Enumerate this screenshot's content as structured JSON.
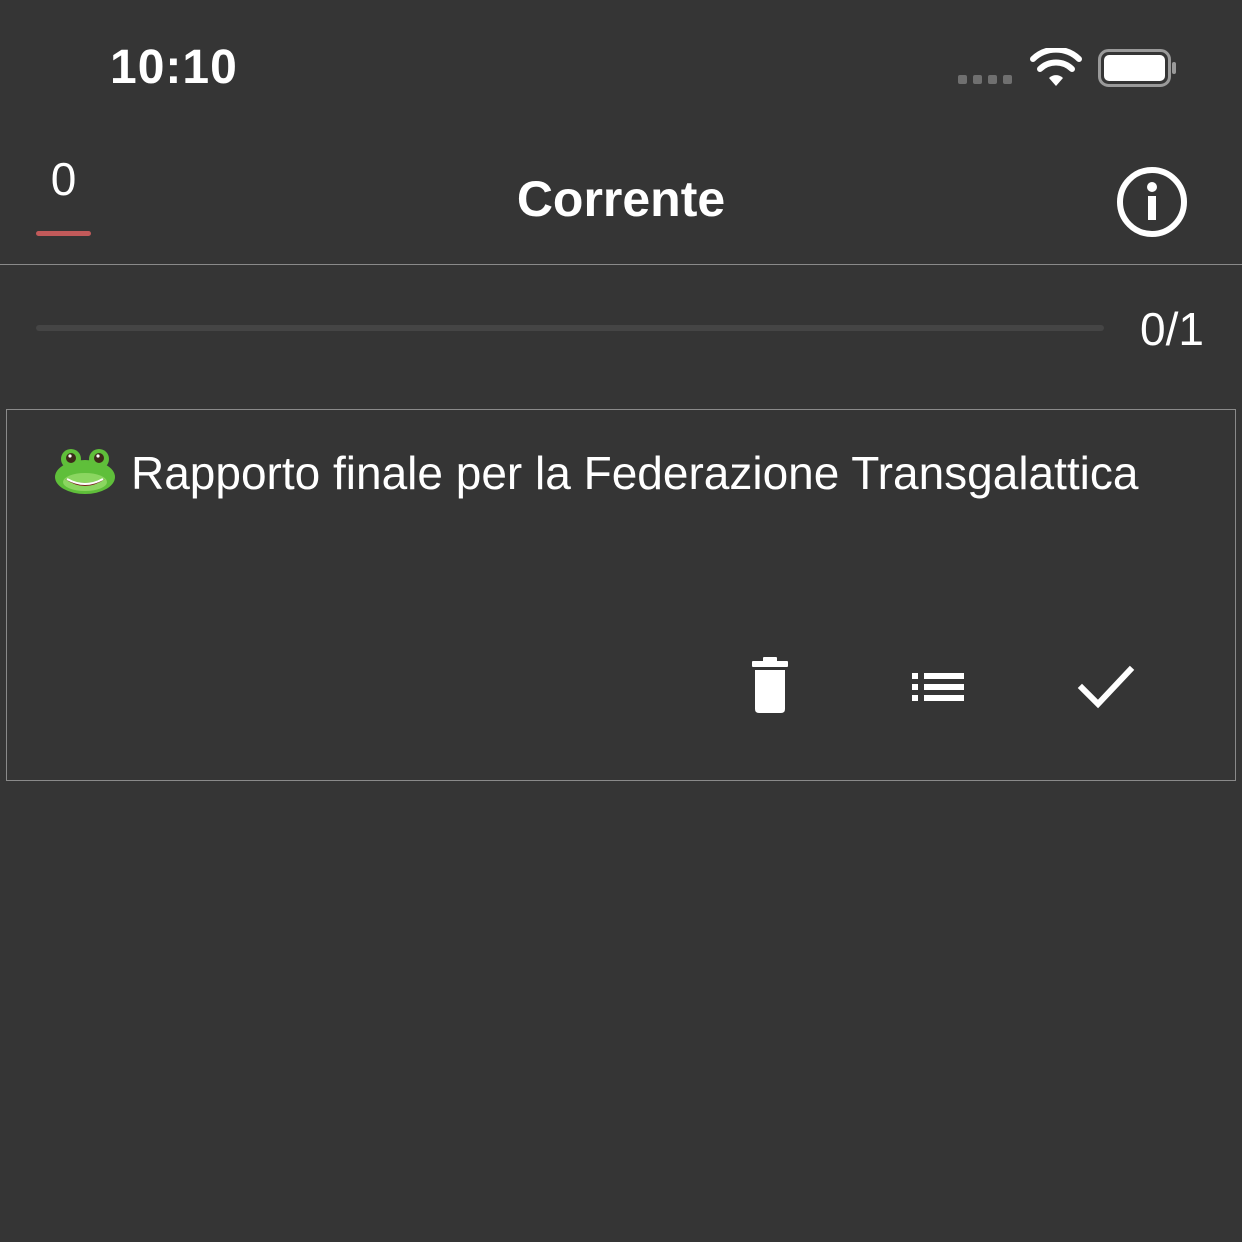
{
  "status_bar": {
    "time": "10:10",
    "icons": [
      "signal-icon",
      "wifi-icon",
      "battery-icon"
    ]
  },
  "nav": {
    "score": "0",
    "title": "Corrente",
    "info_icon": "info-icon"
  },
  "progress": {
    "label": "0/1",
    "fraction": 0
  },
  "task": {
    "emoji_icon": "frog-icon",
    "title": "Rapporto finale per la Federazione Transgalattica",
    "actions": [
      "trash-icon",
      "list-icon",
      "checkmark-icon"
    ]
  },
  "colors": {
    "background": "#353535",
    "accent": "#c25a5a",
    "border": "#8a8a8a"
  }
}
